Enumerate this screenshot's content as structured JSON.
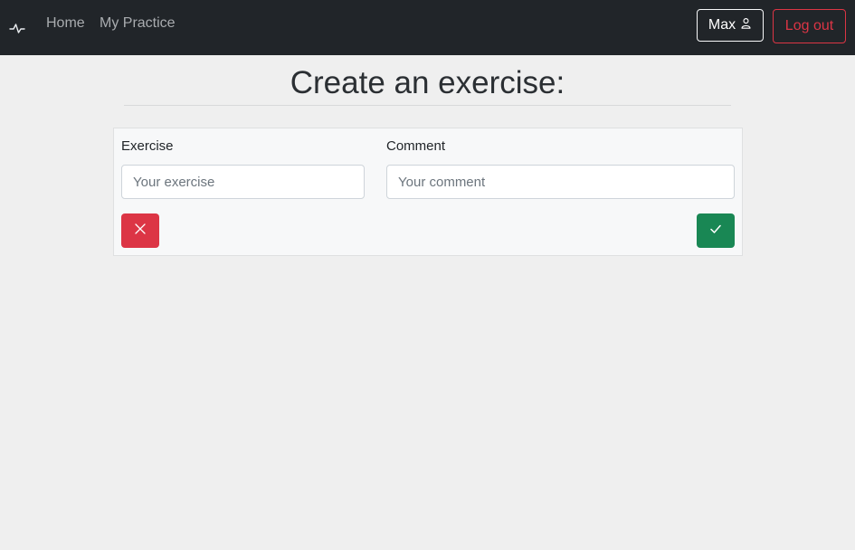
{
  "nav": {
    "brand_icon": "activity-pulse-icon",
    "links": [
      {
        "label": "Home"
      },
      {
        "label": "My Practice"
      }
    ],
    "user": {
      "label": "Max",
      "icon": "person-icon"
    },
    "logout_label": "Log out"
  },
  "page": {
    "title": "Create an exercise:"
  },
  "form": {
    "exercise": {
      "label": "Exercise",
      "placeholder": "Your exercise",
      "value": ""
    },
    "comment": {
      "label": "Comment",
      "placeholder": "Your comment",
      "value": ""
    },
    "cancel_icon": "x-icon",
    "confirm_icon": "check-icon"
  },
  "colors": {
    "navbar_bg": "#212529",
    "danger": "#dc3545",
    "success": "#198754",
    "page_bg": "#efefef"
  }
}
